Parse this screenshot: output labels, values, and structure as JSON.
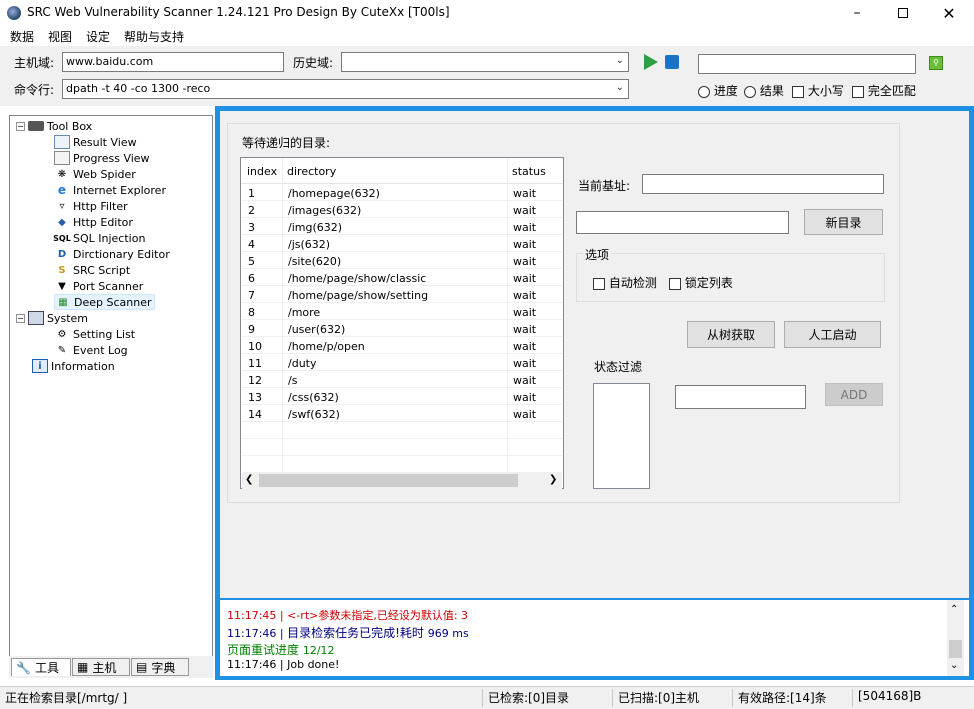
{
  "window": {
    "title": "SRC Web Vulnerability Scanner 1.24.121 Pro Design By CuteXx [T00ls]",
    "minimize_icon": "minimize-icon",
    "maximize_icon": "maximize-icon",
    "close_icon": "close-icon"
  },
  "menu": [
    "数据",
    "视图",
    "设定",
    "帮助与支持"
  ],
  "toolbar": {
    "host_label": "主机域:",
    "host_value": "www.baidu.com",
    "history_label": "历史域:",
    "history_value": "",
    "command_label": "命令行:",
    "command_value": "dpath -t 40 -co 1300 -reco",
    "search_value": "",
    "radio_progress": "进度",
    "radio_result": "结果",
    "check_case": "大小写",
    "check_full": "完全匹配"
  },
  "tree": {
    "toolbox": "Tool Box",
    "items": [
      "Result View",
      "Progress View",
      "Web Spider",
      "Internet Explorer",
      "Http Filter",
      "Http Editor",
      "SQL Injection",
      "Dirctionary Editor",
      "SRC Script",
      "Port Scanner",
      "Deep Scanner"
    ],
    "system": "System",
    "system_items": [
      "Setting List",
      "Event Log"
    ],
    "information": "Information"
  },
  "bottom_tabs": [
    "工具",
    "主机",
    "字典"
  ],
  "scanner": {
    "pending_label": "等待递归的目录:",
    "columns": [
      "index",
      "directory",
      "status"
    ],
    "rows": [
      {
        "index": "1",
        "directory": "/homepage(632)",
        "status": "wait"
      },
      {
        "index": "2",
        "directory": "/images(632)",
        "status": "wait"
      },
      {
        "index": "3",
        "directory": "/img(632)",
        "status": "wait"
      },
      {
        "index": "4",
        "directory": "/js(632)",
        "status": "wait"
      },
      {
        "index": "5",
        "directory": "/site(620)",
        "status": "wait"
      },
      {
        "index": "6",
        "directory": "/home/page/show/classic",
        "status": "wait"
      },
      {
        "index": "7",
        "directory": "/home/page/show/setting",
        "status": "wait"
      },
      {
        "index": "8",
        "directory": "/more",
        "status": "wait"
      },
      {
        "index": "9",
        "directory": "/user(632)",
        "status": "wait"
      },
      {
        "index": "10",
        "directory": "/home/p/open",
        "status": "wait"
      },
      {
        "index": "11",
        "directory": "/duty",
        "status": "wait"
      },
      {
        "index": "12",
        "directory": "/s",
        "status": "wait"
      },
      {
        "index": "13",
        "directory": "/css(632)",
        "status": "wait"
      },
      {
        "index": "14",
        "directory": "/swf(632)",
        "status": "wait"
      }
    ],
    "base_label": "当前基址:",
    "base_value": "",
    "new_dir_value": "",
    "new_dir_button": "新目录",
    "options_label": "选项",
    "auto_detect": "自动检测",
    "lock_list": "锁定列表",
    "from_tree_button": "从树获取",
    "manual_start_button": "人工启动",
    "status_filter_label": "状态过滤",
    "filter_value": "",
    "add_button": "ADD"
  },
  "log": [
    {
      "time": "11:17:45 | ",
      "text": "<-rt>参数未指定,已经设为默认值: 3",
      "color": "#cc0000"
    },
    {
      "time": "11:17:46 | ",
      "text": "目录检索任务已完成!耗时 ",
      "extra": "969 ms",
      "color": "#000080"
    },
    {
      "time": "页面重试进度  ",
      "text": "12/12",
      "color": "#008000"
    },
    {
      "time": "11:17:46 | ",
      "text": "Job done!",
      "color": "#000000"
    }
  ],
  "status": {
    "current": "正在检索目录[/mrtg/ ]",
    "scanned_dirs": "已检索:[0]目录",
    "scanned_hosts": "已扫描:[0]主机",
    "valid_paths": "有效路径:[14]条",
    "bytes": "[504168]B"
  },
  "colors": {
    "accent_blue": "#1e90e6",
    "play_green": "#2ea043",
    "stop_blue": "#1a73c7"
  }
}
